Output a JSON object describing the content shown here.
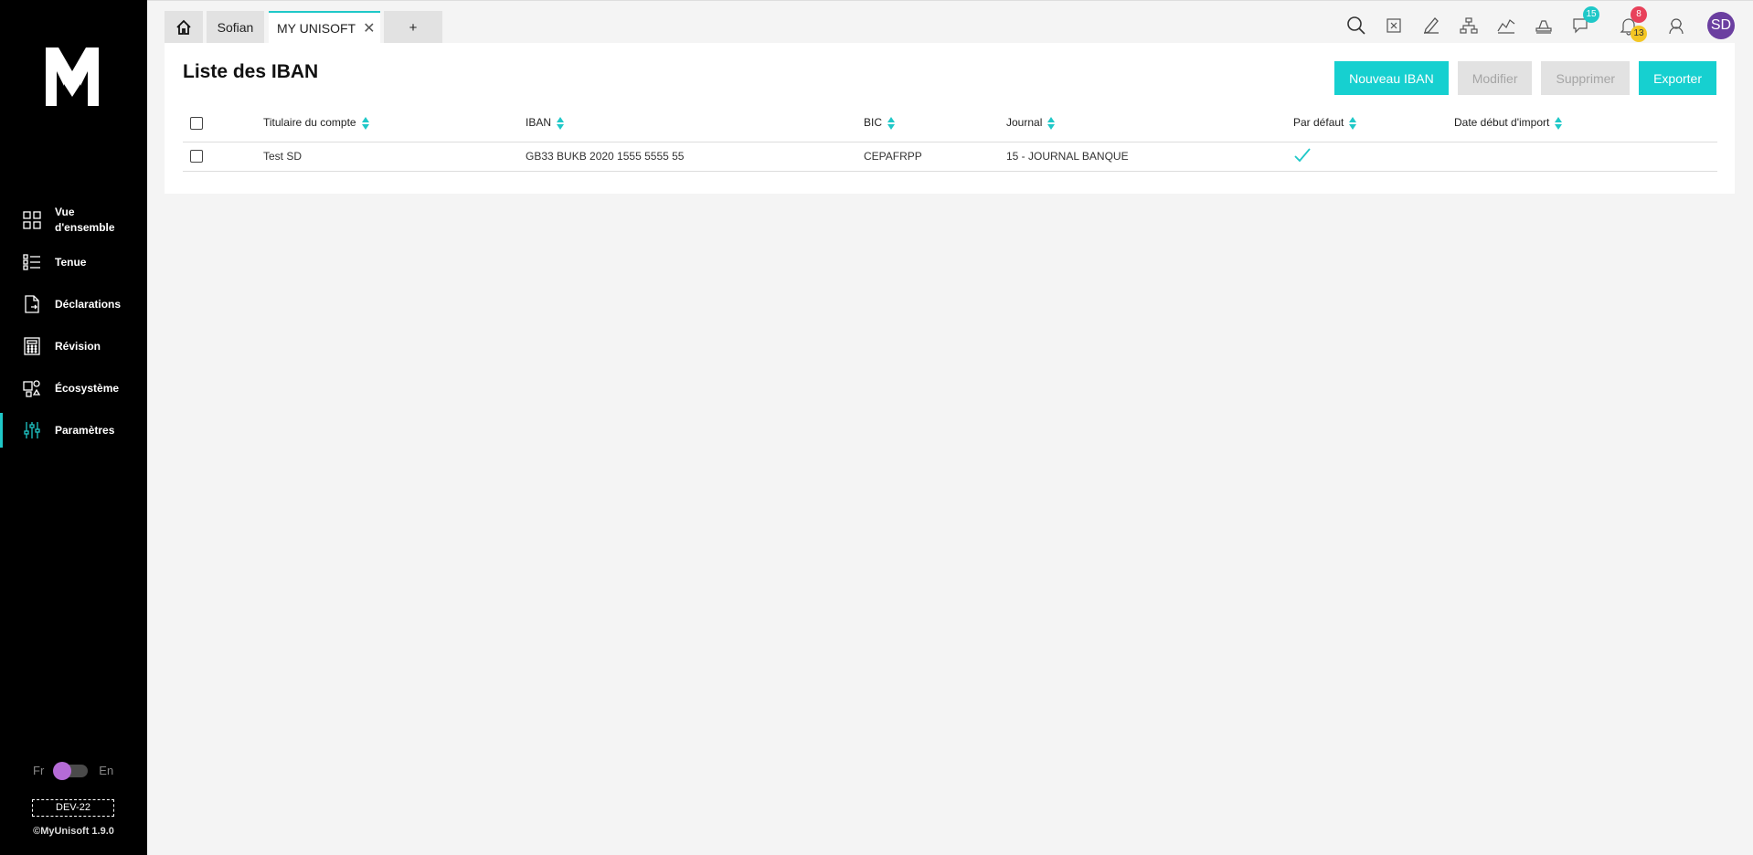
{
  "sidebar": {
    "logo": "My",
    "items": [
      {
        "label": "Vue d'ensemble",
        "icon": "grid-icon"
      },
      {
        "label": "Tenue",
        "icon": "list-icon"
      },
      {
        "label": "Déclarations",
        "icon": "document-icon"
      },
      {
        "label": "Révision",
        "icon": "calculator-icon"
      },
      {
        "label": "Écosystème",
        "icon": "ecosystem-icon"
      },
      {
        "label": "Paramètres",
        "icon": "sliders-icon",
        "active": true
      }
    ],
    "lang_fr": "Fr",
    "lang_en": "En",
    "env": "DEV-22",
    "copyright": "©MyUnisoft 1.9.0"
  },
  "tabs": {
    "home_icon": "home-icon",
    "sofian": "Sofian",
    "active": "MY UNISOFT",
    "plus": "+"
  },
  "toolbar": {
    "icons": [
      "search-icon",
      "calculator-x-icon",
      "edit-icon",
      "org-chart-icon",
      "chart-icon",
      "stamp-icon",
      "chat-icon",
      "bell-icon",
      "support-icon"
    ],
    "chat_badge": "15",
    "bell_badge_red": "8",
    "bell_badge_yellow": "13",
    "avatar": "SD"
  },
  "page": {
    "title": "Liste des IBAN",
    "buttons": {
      "new": "Nouveau IBAN",
      "edit": "Modifier",
      "delete": "Supprimer",
      "export": "Exporter"
    }
  },
  "table": {
    "headers": [
      "Titulaire du compte",
      "IBAN",
      "BIC",
      "Journal",
      "Par défaut",
      "Date début d'import"
    ],
    "rows": [
      {
        "titulaire": "Test SD",
        "iban": "GB33 BUKB 2020 1555 5555 55",
        "bic": "CEPAFRPP",
        "journal": "15 - JOURNAL BANQUE",
        "default": true,
        "date": ""
      }
    ]
  },
  "colors": {
    "accent": "#16d0d0",
    "sidebar_bg": "#000000",
    "avatar": "#6b3fa0",
    "badge_red": "#e8415a",
    "badge_yellow": "#f3c623"
  }
}
